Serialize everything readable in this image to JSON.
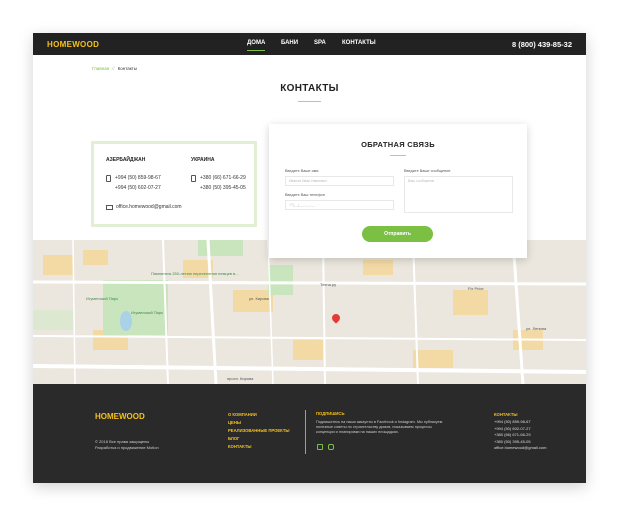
{
  "header": {
    "logo": "HOMEWOOD",
    "nav": [
      "ДОМА",
      "БАНИ",
      "SPA",
      "КОНТАКТЫ"
    ],
    "phone": "8 (800) 439-85-32"
  },
  "breadcrumb": {
    "home": "Главная",
    "separator": "//",
    "current": "Контакты"
  },
  "page_title": "КОНТАКТЫ",
  "contacts": {
    "azerbaijan": {
      "title": "АЗЕРБАЙДЖАН",
      "phones": [
        "+994 (50) 859-98-67",
        "+994 (50) 602-07-27"
      ]
    },
    "ukraine": {
      "title": "УКРАИНА",
      "phones": [
        "+380 (66) 671-66-29",
        "+380 (50) 395-45-05"
      ]
    },
    "email": "office.homewood@gmail.com"
  },
  "form": {
    "title": "ОБРАТНАЯ СВЯЗЬ",
    "name_label": "Введите Ваше имя",
    "name_placeholder": "Иванов Иван Иванович",
    "phone_label": "Введите Ваш телефон",
    "phone_placeholder": "+7(__)___-__-__",
    "message_label": "Введите Ваше сообщение",
    "message_placeholder": "Ваш сообщение",
    "submit": "Отправить"
  },
  "map": {
    "labels": {
      "park_top": "Пампятник 250-летию переселения немцев в...",
      "park": "Игуменский Парк",
      "park2": "Игуменский Парк",
      "street1": "ул. Кирова",
      "street2": "просп. Кирова",
      "tech": "Техна.ру",
      "fix": "Fix Price",
      "lenin": "ул. Ленина"
    }
  },
  "footer": {
    "logo": "HOMEWOOD",
    "copyright": "© 2018 Все права защищены",
    "developer": "Разработка и продвижение Motion",
    "menu": [
      "О КОМПАНИИ",
      "ЦЕНЫ",
      "РЕАЛИЗОВАННЫЕ ПРОЕКТЫ",
      "БЛОГ",
      "КОНТАКТЫ"
    ],
    "subscribe_title": "ПОДПИШИСЬ",
    "subscribe_text": "Подпишитесь на наши аккаунты в Facebook и Instagram. Мы публикуем полезные советы по строительству домов, показываем процессы концепции и планировки на наших площадках.",
    "contacts_title": "КОНТАКТЫ",
    "contacts": [
      "+994 (50) 859-98-67",
      "+994 (50) 602-07-27",
      "+380 (66) 671-66-29",
      "+380 (50) 395-45-05",
      "office.homewood@gmail.com"
    ]
  }
}
